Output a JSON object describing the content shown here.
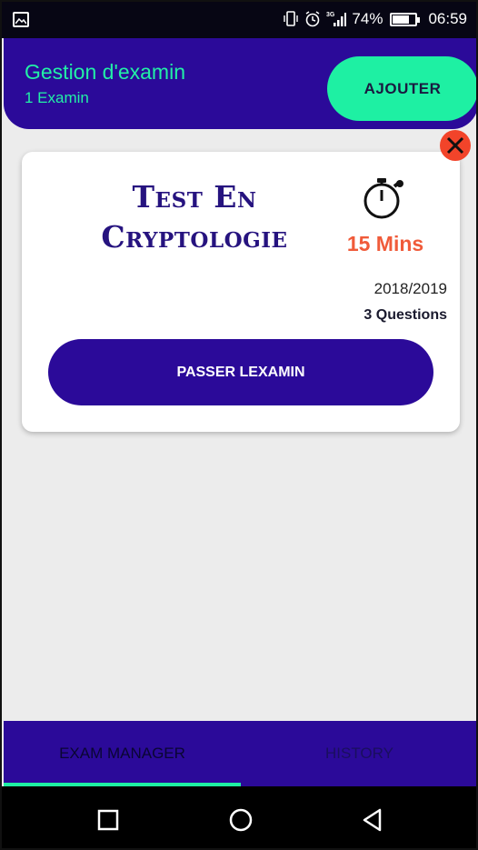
{
  "status_bar": {
    "battery": "74%",
    "battery_level": 0.74,
    "time": "06:59",
    "network": "3G",
    "icons": [
      "gallery-icon",
      "vibrate-icon",
      "alarm-icon",
      "signal-icon",
      "battery-icon"
    ]
  },
  "header": {
    "title": "Gestion d'examin",
    "subtitle": "1 Examin",
    "add_label": "AJOUTER"
  },
  "exam_card": {
    "title": "Test En Cryptologie",
    "duration": "15 Mins",
    "year": "2018/2019",
    "questions": "3 Questions",
    "pass_label": "PASSER LEXAMIN",
    "icons": [
      "timer-icon",
      "close-icon"
    ]
  },
  "tabs": [
    {
      "label": "EXAM MANAGER",
      "selected": true
    },
    {
      "label": "HISTORY",
      "selected": false
    }
  ],
  "nav_bar": {
    "icons": [
      "recents-icon",
      "home-icon",
      "back-icon"
    ]
  },
  "colors": {
    "primary": "#2b0a99",
    "accent": "#1ef0a3",
    "duration": "#f05b3a",
    "close": "#f2442a",
    "title": "#26137f"
  }
}
